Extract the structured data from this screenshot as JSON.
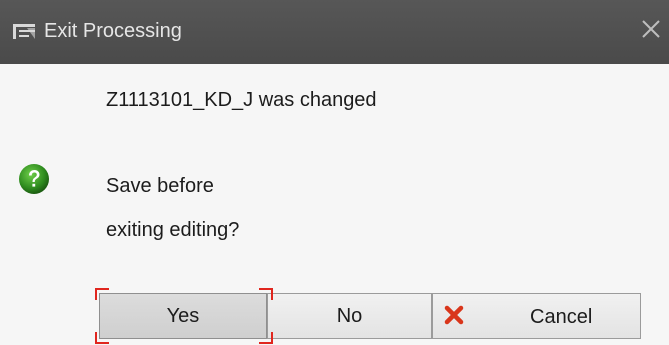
{
  "window": {
    "title": "Exit Processing",
    "title_icon": "window-icon",
    "close_icon": "close-icon"
  },
  "message": {
    "changed_text": "Z1113101_KD_J was changed",
    "question_icon": "question-icon",
    "question_line1": "Save before",
    "question_line2": "exiting editing?"
  },
  "buttons": {
    "yes_label": "Yes",
    "no_label": "No",
    "cancel_label": "Cancel",
    "cancel_icon": "cancel-x-icon"
  },
  "colors": {
    "titlebar": "#4f4f4f",
    "focus_accent": "#e0261e",
    "question_green": "#2e8b1e",
    "cancel_icon_red": "#d9361b"
  }
}
